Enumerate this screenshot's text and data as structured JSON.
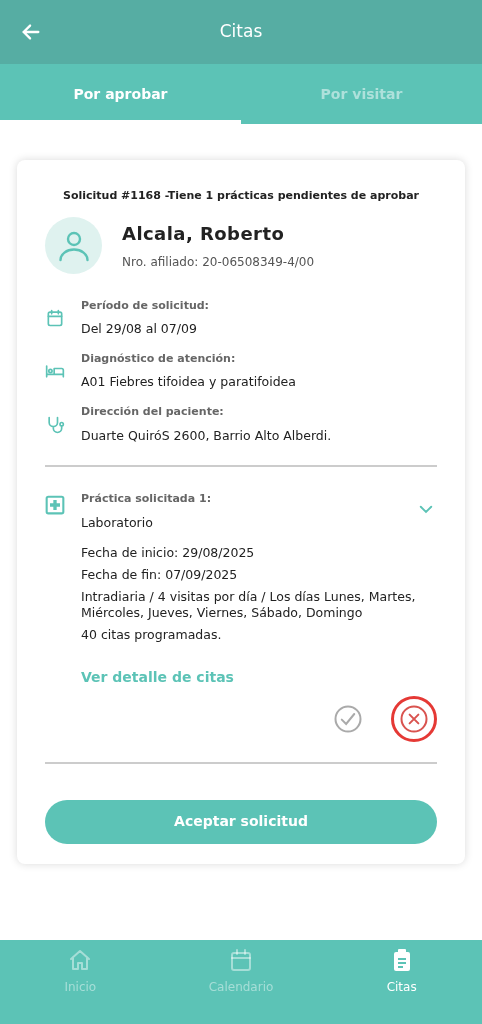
{
  "header": {
    "title": "Citas"
  },
  "tabs": [
    {
      "label": "Por aprobar",
      "selected": true
    },
    {
      "label": "Por visitar",
      "selected": false
    }
  ],
  "request": {
    "title": "Solicitud #1168 -Tiene 1 prácticas pendientes de aprobar",
    "patient_name": "Alcala, Roberto",
    "member_number": "Nro. afiliado: 20-06508349-4/00",
    "details": [
      {
        "kind": "calendar",
        "label": "Período de solicitud:",
        "value": "Del 29/08 al 07/09"
      },
      {
        "kind": "bed",
        "label": "Diagnóstico de atención:",
        "value": "A01 Fiebres tifoidea y paratifoidea"
      },
      {
        "kind": "stethoscope",
        "label": "Dirección del paciente:",
        "value": "Duarte QuiróS  2600, Barrio Alto Alberdi."
      }
    ],
    "practice": {
      "label": "Práctica solicitada 1:",
      "name": "Laboratorio",
      "lines": [
        "Fecha de inicio: 29/08/2025",
        "Fecha de fin: 07/09/2025",
        "Intradiaria / 4 visitas por día /  Los días Lunes, Martes, Miércoles, Jueves, Viernes, Sábado, Domingo",
        "40 citas programadas."
      ],
      "link": "Ver detalle de citas",
      "actions": [
        {
          "kind": "approve",
          "selected": false
        },
        {
          "kind": "reject",
          "selected": true
        }
      ]
    },
    "accept_button": "Aceptar solicitud"
  },
  "bottom_nav": [
    {
      "kind": "home",
      "label": "Inicio",
      "selected": false
    },
    {
      "kind": "calendar",
      "label": "Calendario",
      "selected": false
    },
    {
      "kind": "clipboard",
      "label": "Citas",
      "selected": true
    }
  ]
}
